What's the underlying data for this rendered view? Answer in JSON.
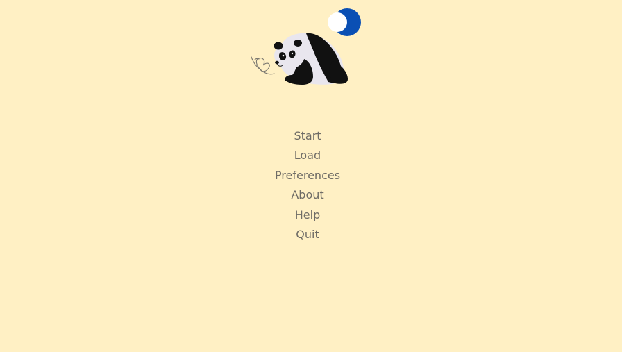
{
  "colors": {
    "background": "#fff0c4",
    "menu_text": "#6f6c66",
    "moon_blue": "#0a4fb4",
    "moon_light": "#ffffff",
    "panda_black": "#111111",
    "panda_white": "#e9e6ee",
    "butterfly_stroke": "#7a776f"
  },
  "logo": {
    "icon": "panda-moon-logo",
    "parts": [
      "crescent-moon-icon",
      "panda-icon",
      "butterfly-icon"
    ]
  },
  "menu": {
    "items": [
      {
        "label": "Start"
      },
      {
        "label": "Load"
      },
      {
        "label": "Preferences"
      },
      {
        "label": "About"
      },
      {
        "label": "Help"
      },
      {
        "label": "Quit"
      }
    ]
  }
}
